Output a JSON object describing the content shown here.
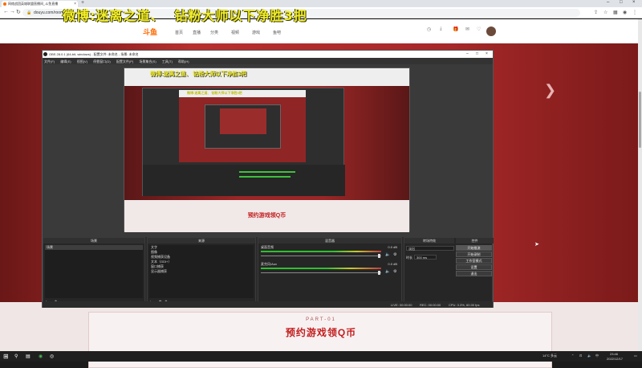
{
  "browser": {
    "tab_title": "网络战团英雄联盟直播间_斗鱼直播",
    "url": "douyu.com/room/...",
    "overlay_title": "微博:迷离之道、  钻粉大师以下净胜3把"
  },
  "site": {
    "logo": "斗鱼",
    "nav": [
      "首页",
      "直播",
      "分类",
      "视频",
      "游戏",
      "鱼吧"
    ],
    "bottom_part": "PART-01",
    "bottom_title": "预约游戏领Q币"
  },
  "obs": {
    "title": "OBS 28.0.1 (64-bit, windows) - 配置文件: 未命名 - 场景: 未命名",
    "menu": [
      "文件(F)",
      "编辑(E)",
      "视图(V)",
      "停靠窗口(D)",
      "配置文件(P)",
      "场景集合(S)",
      "工具(T)",
      "帮助(H)"
    ],
    "nested_title": "微博:迷离之道、 钻粉大师以下净胜3把",
    "nested_bottom": "预约游戏领Q币",
    "docks": {
      "scenes_header": "场景",
      "scenes": [
        "场景"
      ],
      "sources_header": "来源",
      "sources": [
        "文字",
        "图像",
        "视频捕获设备",
        "文本（GDI+）",
        "窗口捕获",
        "显示器捕获"
      ],
      "mixer_header": "混音器",
      "mixer": [
        {
          "name": "桌面音频",
          "db": "0.0 dB"
        },
        {
          "name": "麦克风/Aux",
          "db": "0.0 dB"
        }
      ],
      "transitions_header": "转场特效",
      "transition_value": "淡出",
      "duration_label": "时长",
      "duration_value": "300 ms",
      "controls_header": "控件",
      "controls": [
        "开始推流",
        "开始录制",
        "工作室模式",
        "设置",
        "退出"
      ]
    },
    "status": {
      "live": "LIVE: 00:00:00",
      "rec": "REC: 00:00:00",
      "cpu": "CPU: 3.3%, 60.00 fps"
    }
  },
  "taskbar": {
    "weather": "14°C 多云",
    "time": "23:46",
    "date": "2022/12/17"
  },
  "colors": {
    "overlay_yellow": "#f2ee2a",
    "douyu_orange": "#ff6a00",
    "banner_red": "#b22a2a",
    "title_red": "#c21e1e"
  }
}
